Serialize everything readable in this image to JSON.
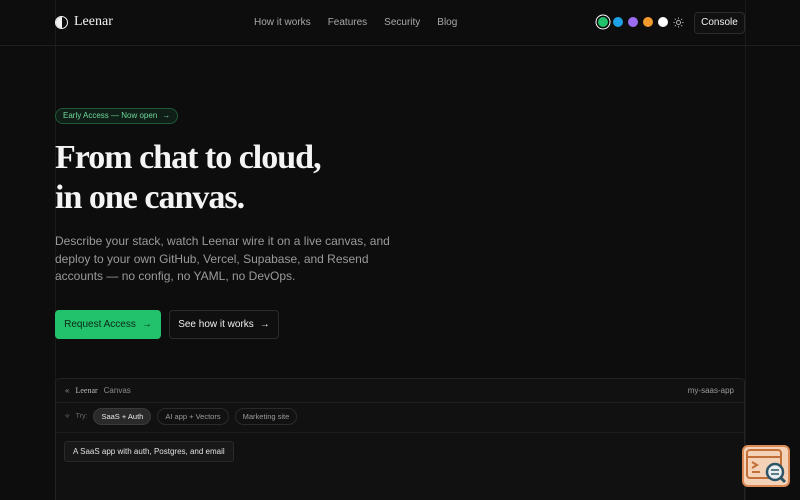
{
  "header": {
    "brand": "Leenar",
    "nav": [
      "How it works",
      "Features",
      "Security",
      "Blog"
    ],
    "theme_colors": [
      "#22c16b",
      "#1ea0e6",
      "#9b6bf0",
      "#f29a2e",
      "#ffffff"
    ],
    "console_label": "Console"
  },
  "hero": {
    "badge": "Early Access — Now open",
    "title_line1": "From chat to cloud,",
    "title_line2": "in one canvas.",
    "subtitle": "Describe your stack, watch Leenar wire it on a live canvas, and deploy to your own GitHub, Vercel, Supabase, and Resend accounts — no config, no YAML, no DevOps.",
    "primary_cta": "Request Access",
    "secondary_cta": "See how it works"
  },
  "canvas_panel": {
    "brand": "Leenar",
    "label": "Canvas",
    "project": "my-saas-app",
    "try_label": "Try:",
    "chips": [
      "SaaS + Auth",
      "AI app + Vectors",
      "Marketing site"
    ],
    "prompt": "A SaaS app with auth, Postgres, and email"
  },
  "colors": {
    "accent": "#22c16b",
    "background": "#0d0d0d"
  }
}
